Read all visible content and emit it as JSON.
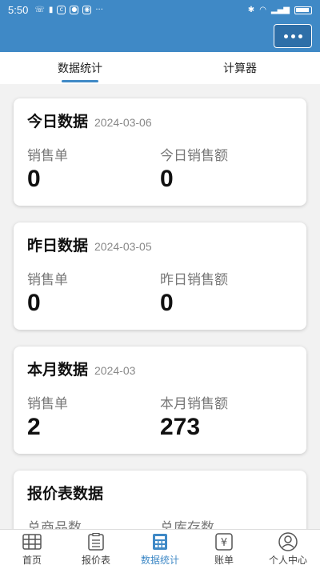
{
  "status_bar": {
    "time": "5:50"
  },
  "tabs": [
    {
      "label": "数据统计",
      "active": true
    },
    {
      "label": "计算器",
      "active": false
    }
  ],
  "cards": {
    "today": {
      "title": "今日数据",
      "date": "2024-03-06",
      "left_label": "销售单",
      "left_value": "0",
      "right_label": "今日销售额",
      "right_value": "0"
    },
    "yesterday": {
      "title": "昨日数据",
      "date": "2024-03-05",
      "left_label": "销售单",
      "left_value": "0",
      "right_label": "昨日销售额",
      "right_value": "0"
    },
    "month": {
      "title": "本月数据",
      "date": "2024-03",
      "left_label": "销售单",
      "left_value": "2",
      "right_label": "本月销售额",
      "right_value": "273"
    },
    "quote": {
      "title": "报价表数据",
      "left_label": "总商品数",
      "right_label": "总库存数"
    }
  },
  "bottom_nav": [
    {
      "label": "首页",
      "icon": "grid-icon"
    },
    {
      "label": "报价表",
      "icon": "list-icon"
    },
    {
      "label": "数据统计",
      "icon": "calculator-icon",
      "active": true
    },
    {
      "label": "账单",
      "icon": "yuan-icon"
    },
    {
      "label": "个人中心",
      "icon": "user-icon"
    }
  ],
  "colors": {
    "primary": "#3f89c6"
  }
}
